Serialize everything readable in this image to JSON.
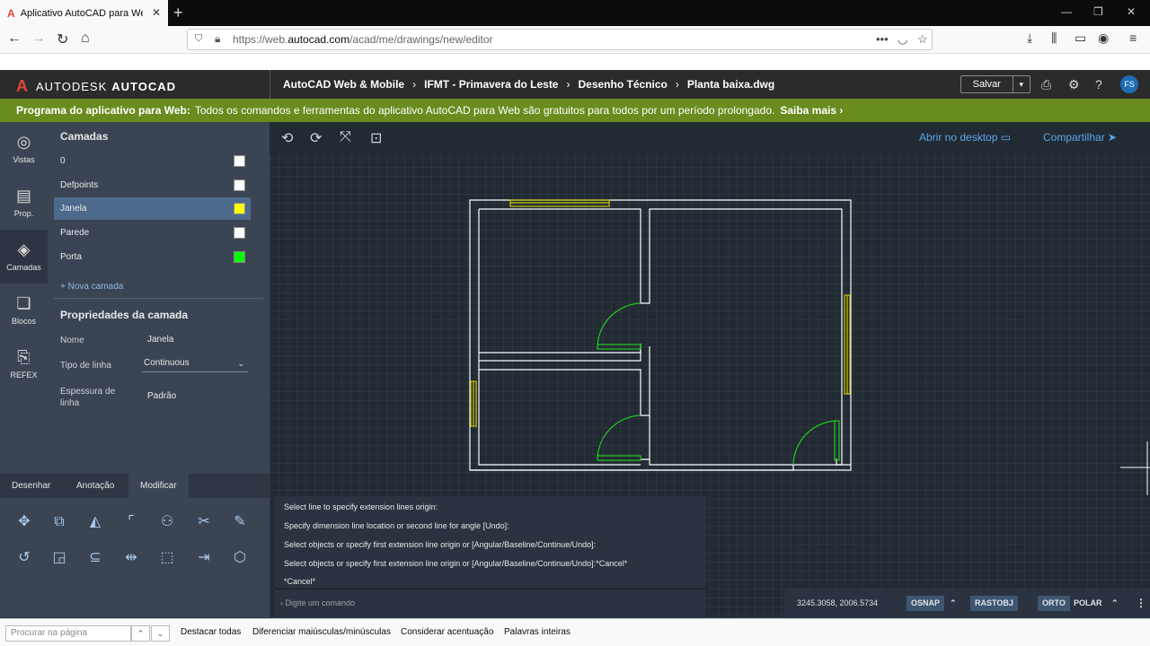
{
  "browser": {
    "tab_title": "Aplicativo AutoCAD para Web",
    "url_prefix": "https://web.",
    "url_domain": "autocad.com",
    "url_path": "/acad/me/drawings/new/editor"
  },
  "header": {
    "brand_left": "AUTODESK",
    "brand_right": "AUTOCAD",
    "breadcrumbs": [
      "AutoCAD Web & Mobile",
      "IFMT - Primavera do Leste",
      "Desenho Técnico",
      "Planta baixa.dwg"
    ],
    "save_label": "Salvar",
    "avatar_initials": "FS"
  },
  "banner": {
    "bold": "Programa do aplicativo para Web:",
    "text": "Todos os comandos e ferramentas do aplicativo AutoCAD para Web são gratuitos para todos por um período prolongado.",
    "link": "Saiba mais ›"
  },
  "rail": [
    "Vistas",
    "Prop.",
    "Camadas",
    "Blocos",
    "REFEX"
  ],
  "layers": {
    "title": "Camadas",
    "items": [
      {
        "name": "0",
        "color": "#ffffff"
      },
      {
        "name": "Defpoints",
        "color": "#ffffff"
      },
      {
        "name": "Janela",
        "color": "#ffff00"
      },
      {
        "name": "Parede",
        "color": "#ffffff"
      },
      {
        "name": "Porta",
        "color": "#00ff00"
      }
    ],
    "new_layer": "+ Nova camada"
  },
  "properties": {
    "title": "Propriedades da camada",
    "name_label": "Nome",
    "name_value": "Janela",
    "ltype_label": "Tipo de linha",
    "ltype_value": "Continuous",
    "weight_label": "Espessura de linha",
    "weight_value": "Padrão"
  },
  "tools_tabs": [
    "Desenhar",
    "Anotação",
    "Modificar"
  ],
  "canvas": {
    "open_desktop": "Abrir no desktop",
    "share": "Compartilhar"
  },
  "command_history": [
    "Select line to specify extension lines origin:",
    "Specify dimension line location or second line for angle [Undo]:",
    "Select objects or specify first extension line origin or [Angular/Baseline/Continue/Undo]:",
    "Select objects or specify first extension line origin or [Angular/Baseline/Continue/Undo]:*Cancel*",
    "*Cancel*"
  ],
  "command_placeholder": "› Digite um comando",
  "status": {
    "coords": "3245.3058, 2006.5734",
    "osnap": "OSNAP",
    "rastobj": "RASTOBJ",
    "orto": "ORTO",
    "polar": "POLAR"
  },
  "findbar": {
    "placeholder": "Procurar na página",
    "options": [
      "Destacar todas",
      "Diferenciar maiúsculas/minúsculas",
      "Considerar acentuação",
      "Palavras inteiras"
    ]
  },
  "colors": {
    "wall": "#ffffff",
    "window": "#c8c800",
    "door": "#22cc22",
    "banner": "#6a8c1f"
  }
}
